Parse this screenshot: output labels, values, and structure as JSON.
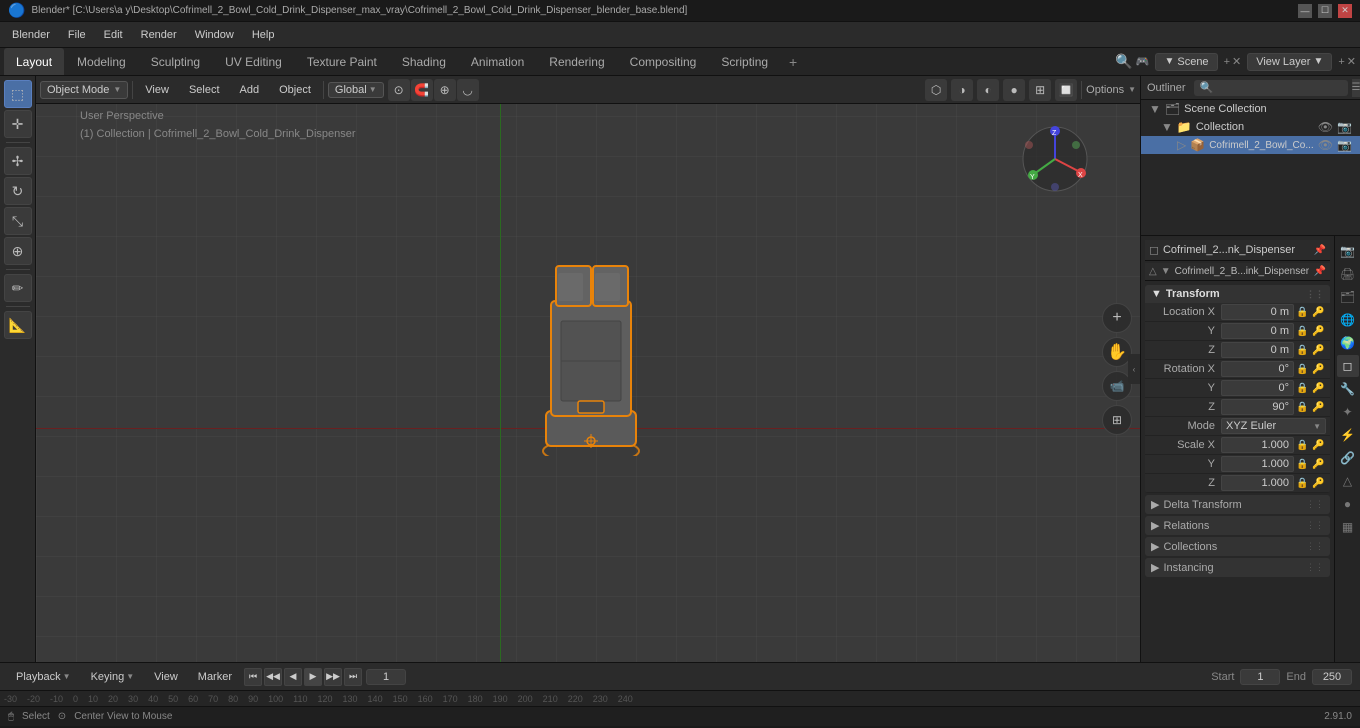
{
  "titleBar": {
    "title": "Blender* [C:\\Users\\a y\\Desktop\\Cofrimell_2_Bowl_Cold_Drink_Dispenser_max_vray\\Cofrimell_2_Bowl_Cold_Drink_Dispenser_blender_base.blend]",
    "controls": [
      "—",
      "☐",
      "✕"
    ]
  },
  "menuBar": {
    "items": [
      "Blender",
      "File",
      "Edit",
      "Render",
      "Window",
      "Help"
    ]
  },
  "workspaceTabs": {
    "tabs": [
      "Layout",
      "Modeling",
      "Sculpting",
      "UV Editing",
      "Texture Paint",
      "Shading",
      "Animation",
      "Rendering",
      "Compositing",
      "Scripting"
    ],
    "activeTab": "Layout",
    "addIcon": "+",
    "sceneLabel": "Scene",
    "viewLayerLabel": "View Layer",
    "blenderIcon": "🔵"
  },
  "viewportHeader": {
    "modeLabel": "Object Mode",
    "viewLabel": "View",
    "selectLabel": "Select",
    "addLabel": "Add",
    "objectLabel": "Object",
    "globalLabel": "Global",
    "snapIcon": "🧲",
    "proportionalIcon": "⊙",
    "transformPivot": "◈",
    "optionsLabel": "Options"
  },
  "viewportInfo": {
    "perspLabel": "User Perspective",
    "collectionLabel": "(1) Collection | Cofrimell_2_Bowl_Cold_Drink_Dispenser"
  },
  "leftToolbar": {
    "tools": [
      {
        "name": "select-box",
        "icon": "⬚",
        "active": true
      },
      {
        "name": "select-circle",
        "icon": "◯",
        "active": false
      },
      {
        "name": "select-lasso",
        "icon": "⌖",
        "active": false
      },
      {
        "name": "cursor",
        "icon": "✛",
        "active": false
      },
      {
        "name": "move",
        "icon": "✢",
        "active": false
      },
      {
        "name": "rotate",
        "icon": "↻",
        "active": false
      },
      {
        "name": "scale",
        "icon": "⤡",
        "active": false
      },
      {
        "name": "transform",
        "icon": "⊕",
        "active": false
      },
      {
        "name": "annotate",
        "icon": "✏",
        "active": false
      },
      {
        "name": "measure",
        "icon": "📐",
        "active": false
      }
    ]
  },
  "rightPanel": {
    "outliner": {
      "searchPlaceholder": "🔍",
      "items": [
        {
          "label": "Scene Collection",
          "level": 0,
          "icon": "🗂"
        },
        {
          "label": "Collection",
          "level": 1,
          "icon": "📁",
          "eye": "👁",
          "camera": "📷"
        },
        {
          "label": "Cofrimell_2_Bowl_Co...",
          "level": 2,
          "icon": "📦",
          "selected": true
        }
      ]
    },
    "propertyTabs": [
      {
        "name": "scene-icon",
        "icon": "🎬"
      },
      {
        "name": "render-icon",
        "icon": "📷"
      },
      {
        "name": "output-icon",
        "icon": "🖨"
      },
      {
        "name": "view-layer-icon",
        "icon": "🗂"
      },
      {
        "name": "scene-props-icon",
        "icon": "🌐"
      },
      {
        "name": "world-icon",
        "icon": "🌍"
      },
      {
        "name": "object-icon",
        "icon": "◻",
        "active": true
      },
      {
        "name": "modifier-icon",
        "icon": "🔧"
      },
      {
        "name": "particles-icon",
        "icon": "✦"
      },
      {
        "name": "physics-icon",
        "icon": "⚡"
      },
      {
        "name": "constraints-icon",
        "icon": "🔗"
      },
      {
        "name": "object-data-icon",
        "icon": "△"
      },
      {
        "name": "material-icon",
        "icon": "●"
      },
      {
        "name": "texture-icon",
        "icon": "▦"
      }
    ],
    "objectName": "Cofrimell_2...nk_Dispenser",
    "objectSubName": "Cofrimell_2_B...ink_Dispenser",
    "transform": {
      "title": "Transform",
      "locationX": "0 m",
      "locationY": "0 m",
      "locationZ": "0 m",
      "rotationX": "0°",
      "rotationY": "0°",
      "rotationZ": "90°",
      "rotationMode": "XYZ Euler",
      "scaleX": "1.000",
      "scaleY": "1.000",
      "scaleZ": "1.000"
    },
    "deltaTransform": {
      "title": "Delta Transform",
      "collapsed": true
    },
    "relations": {
      "title": "Relations",
      "collapsed": true
    },
    "collections": {
      "title": "Collections",
      "collapsed": true
    },
    "instancing": {
      "title": "Instancing",
      "collapsed": true
    }
  },
  "bottomBar": {
    "playbackLabel": "Playback",
    "keyingLabel": "Keying",
    "viewLabel": "View",
    "markerLabel": "Marker",
    "frameStart": "Start",
    "frameStartVal": "1",
    "frameEnd": "End",
    "frameEndVal": "250",
    "currentFrame": "1",
    "playbackBtns": [
      "⏮",
      "◀◀",
      "◀",
      "▶",
      "▶▶",
      "⏭"
    ],
    "frameInput": "1"
  },
  "statusBar": {
    "selectLabel": "Select",
    "centerViewLabel": "Center View to Mouse",
    "versionLabel": "2.91.0"
  },
  "timelineNumbers": [
    "-30",
    "-20",
    "-10",
    "0",
    "10",
    "20",
    "30",
    "40",
    "50",
    "60",
    "70",
    "80",
    "90",
    "100",
    "110",
    "120",
    "130",
    "140",
    "150",
    "160",
    "170",
    "180",
    "190",
    "200",
    "210",
    "220",
    "230",
    "240"
  ]
}
